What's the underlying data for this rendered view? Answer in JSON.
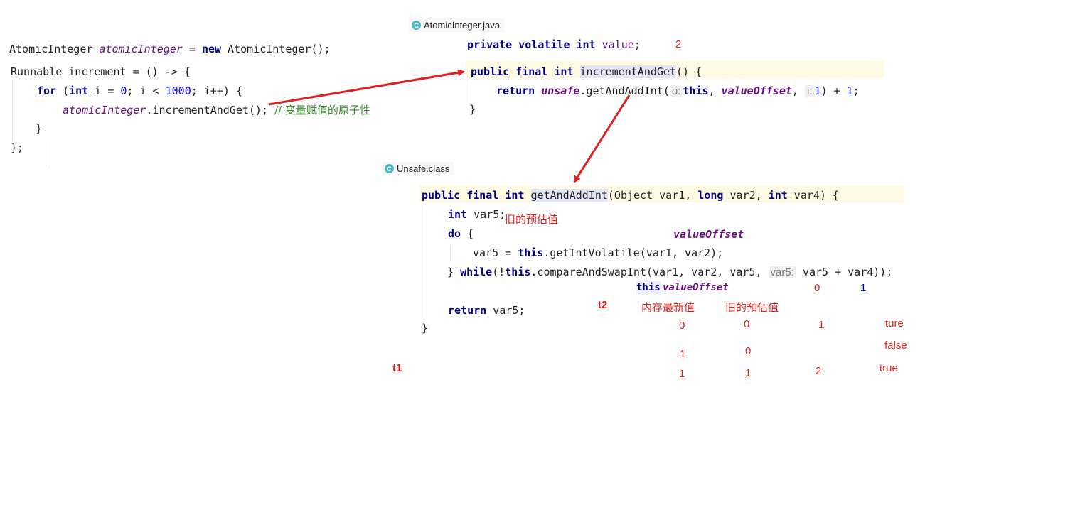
{
  "left_code": {
    "line1_type": "AtomicInteger",
    "line1_var": "atomicInteger",
    "line1_eq": " = ",
    "line1_new": "new",
    "line1_ctor": " AtomicInteger();",
    "line2": "Runnable increment = () -> {",
    "line3_for": "for",
    "line3_a": " (",
    "line3_int": "int",
    "line3_b": " i = ",
    "line3_zero": "0",
    "line3_c": "; i < ",
    "line3_limit": "1000",
    "line3_d": "; i++) {",
    "line4_var": "atomicInteger",
    "line4_call": ".incrementAndGet(); ",
    "line4_comment": "// 变量赋值的原子性",
    "line5": "}",
    "line6": "};"
  },
  "atomic_tab": {
    "icon": "C",
    "label": "AtomicInteger.java"
  },
  "atomic_code": {
    "field_kw": "private volatile int",
    "field_name": "value",
    "field_end": ";",
    "field_value": "2",
    "method_kw": "public final int",
    "method_name": "incrementAndGet",
    "method_rest": "() {",
    "return_kw": "return",
    "unsafe": "unsafe",
    "call": ".getAndAddInt(",
    "hint_o": "o:",
    "this_kw": "this",
    "comma1": ", ",
    "value_offset": "valueOffset",
    "comma2": ", ",
    "hint_i": "i:",
    "one": "1",
    "end": ") + ",
    "plus_one": "1",
    "semi": ";",
    "close": "}"
  },
  "unsafe_tab": {
    "icon": "C",
    "label": "Unsafe.class"
  },
  "unsafe_code": {
    "sig_kw": "public final int",
    "sig_name": "getAndAddInt",
    "sig_a": "(Object var1, ",
    "sig_long": "long",
    "sig_b": " var2, ",
    "sig_int": "int",
    "sig_c": " var4) {",
    "l2_int": "int",
    "l2_rest": " var5;",
    "l3_do": "do",
    "l3_rest": " {",
    "l4_a": "var5 = ",
    "l4_this": "this",
    "l4_b": ".getIntVolatile(var1, var2);",
    "l5_a": "} ",
    "l5_while": "while",
    "l5_b": "(!",
    "l5_this": "this",
    "l5_c": ".compareAndSwapInt(var1, var2, var5, ",
    "l5_hint": "var5:",
    "l5_d": " var5 + var4));",
    "l6_return": "return",
    "l6_rest": " var5;",
    "l7": "}"
  },
  "annotations": {
    "old_expected_1": "旧的预估值",
    "value_offset_1": "valueOffset",
    "this_label": "this",
    "value_offset_2": "valueOffset",
    "col_zero": "0",
    "col_one": "1",
    "t2": "t2",
    "mem_latest": "内存最新值",
    "old_expected_2": "旧的预估值",
    "t1": "t1",
    "rows": [
      {
        "mem": "0",
        "old": "0",
        "new": "1",
        "result": "ture"
      },
      {
        "mem": "1",
        "old": "0",
        "new": "",
        "result": "false"
      },
      {
        "mem": "1",
        "old": "1",
        "new": "2",
        "result": "true"
      }
    ]
  },
  "colors": {
    "arrow": "#e02020",
    "keyword": "#000080",
    "field": "#660e7a",
    "number": "#0000ff",
    "comment": "#3c8a2e"
  }
}
